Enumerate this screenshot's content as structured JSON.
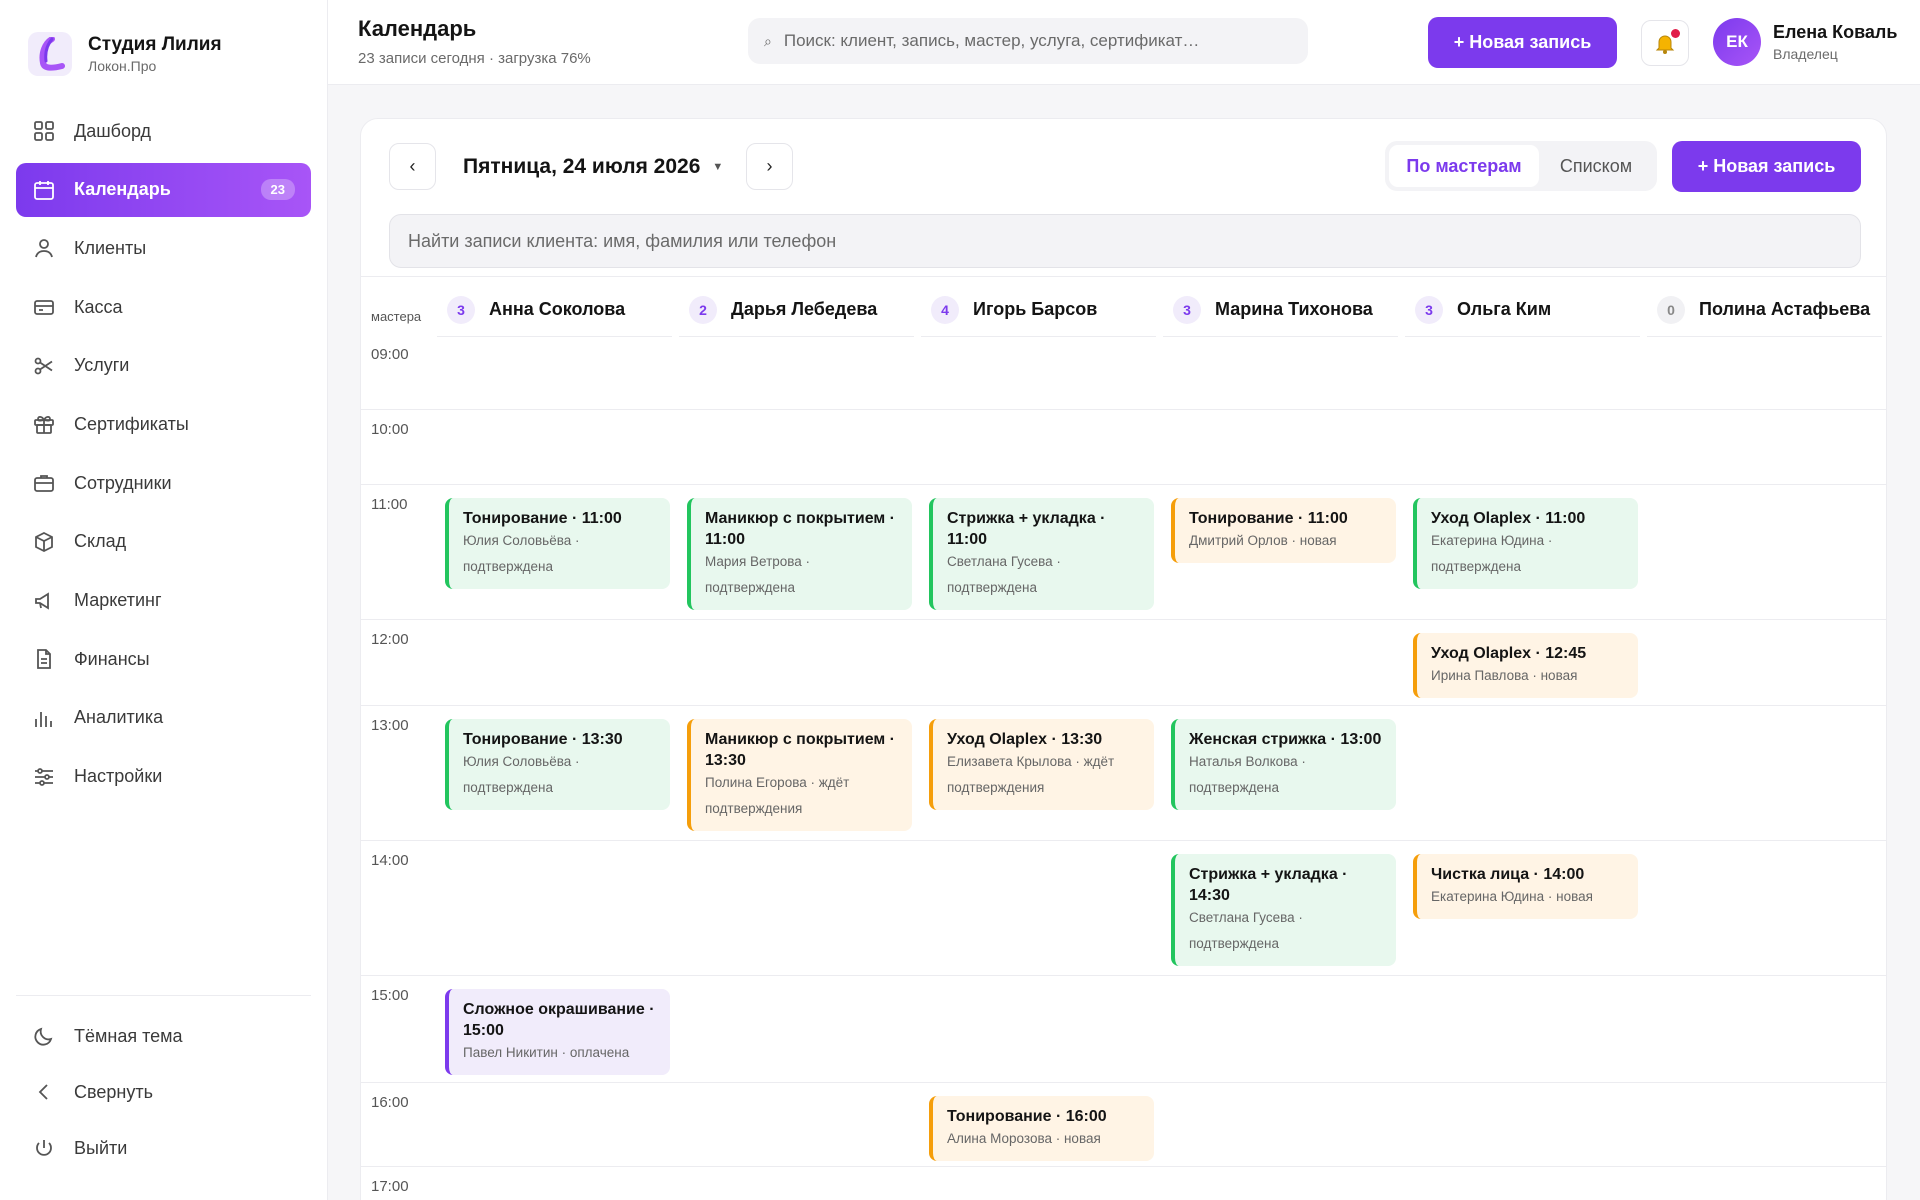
{
  "brand": {
    "name": "Студия Лилия",
    "subtitle": "Локон.Про"
  },
  "nav": [
    {
      "label": "Дашборд",
      "icon": "dashboard-icon"
    },
    {
      "label": "Календарь",
      "icon": "calendar-icon",
      "badge": "23",
      "active": true
    },
    {
      "label": "Клиенты",
      "icon": "user-icon"
    },
    {
      "label": "Касса",
      "icon": "credit-card-icon"
    },
    {
      "label": "Услуги",
      "icon": "scissors-icon"
    },
    {
      "label": "Сертификаты",
      "icon": "gift-icon"
    },
    {
      "label": "Сотрудники",
      "icon": "briefcase-icon"
    },
    {
      "label": "Склад",
      "icon": "box-icon"
    },
    {
      "label": "Маркетинг",
      "icon": "megaphone-icon"
    },
    {
      "label": "Финансы",
      "icon": "document-icon"
    },
    {
      "label": "Аналитика",
      "icon": "bar-chart-icon"
    },
    {
      "label": "Настройки",
      "icon": "sliders-icon"
    }
  ],
  "bottom_nav": [
    {
      "label": "Тёмная тема",
      "icon": "moon-icon"
    },
    {
      "label": "Свернуть",
      "icon": "chevron-left-icon"
    },
    {
      "label": "Выйти",
      "icon": "power-icon"
    }
  ],
  "header": {
    "title": "Календарь",
    "subtitle": "23 записи сегодня · загрузка 76%",
    "search_placeholder": "Поиск: клиент, запись, мастер, услуга, сертификат…",
    "new_button": "+ Новая запись",
    "user": {
      "initials": "ЕК",
      "name": "Елена Коваль",
      "role": "Владелец"
    }
  },
  "calendar": {
    "prev": "‹",
    "next": "›",
    "date": "Пятница, 24 июля 2026",
    "views": [
      "По мастерам",
      "Списком"
    ],
    "new_button": "+ Новая запись",
    "client_search_placeholder": "Найти записи клиента: имя, фамилия или телефон",
    "masters_label": "мастера",
    "masters": [
      {
        "count": "3",
        "name": "Анна Соколова"
      },
      {
        "count": "2",
        "name": "Дарья Лебедева"
      },
      {
        "count": "4",
        "name": "Игорь Барсов"
      },
      {
        "count": "3",
        "name": "Марина Тихонова"
      },
      {
        "count": "3",
        "name": "Ольга Ким"
      },
      {
        "count": "0",
        "name": "Полина Астафьева"
      }
    ],
    "hours": [
      "09:00",
      "10:00",
      "11:00",
      "12:00",
      "13:00",
      "14:00",
      "15:00",
      "16:00",
      "17:00"
    ],
    "appointments": [
      {
        "master": 0,
        "slot": 2,
        "status": "green",
        "title": "Тонирование · 11:00",
        "line1": "Юлия Соловьёва ·",
        "line2": "подтверждена"
      },
      {
        "master": 1,
        "slot": 2,
        "status": "green",
        "title": "Маникюр с покрытием · 11:00",
        "line1": "Мария Ветрова ·",
        "line2": "подтверждена"
      },
      {
        "master": 2,
        "slot": 2,
        "status": "green",
        "title": "Стрижка + укладка · 11:00",
        "line1": "Светлана Гусева ·",
        "line2": "подтверждена"
      },
      {
        "master": 3,
        "slot": 2,
        "status": "orange",
        "title": "Тонирование · 11:00",
        "line1": "Дмитрий Орлов · новая",
        "line2": ""
      },
      {
        "master": 4,
        "slot": 2,
        "status": "green",
        "title": "Уход Olaplex · 11:00",
        "line1": "Екатерина Юдина ·",
        "line2": "подтверждена"
      },
      {
        "master": 4,
        "slot": 3,
        "status": "orange",
        "title": "Уход Olaplex · 12:45",
        "line1": "Ирина Павлова · новая",
        "line2": ""
      },
      {
        "master": 0,
        "slot": 4,
        "status": "green",
        "title": "Тонирование · 13:30",
        "line1": "Юлия Соловьёва ·",
        "line2": "подтверждена"
      },
      {
        "master": 1,
        "slot": 4,
        "status": "orange",
        "title": "Маникюр с покрытием · 13:30",
        "line1": "Полина Егорова · ждёт",
        "line2": "подтверждения"
      },
      {
        "master": 2,
        "slot": 4,
        "status": "orange",
        "title": "Уход Olaplex · 13:30",
        "line1": "Елизавета Крылова · ждёт",
        "line2": "подтверждения"
      },
      {
        "master": 3,
        "slot": 4,
        "status": "green",
        "title": "Женская стрижка · 13:00",
        "line1": "Наталья Волкова ·",
        "line2": "подтверждена"
      },
      {
        "master": 3,
        "slot": 5,
        "status": "green",
        "title": "Стрижка + укладка · 14:30",
        "line1": "Светлана Гусева ·",
        "line2": "подтверждена"
      },
      {
        "master": 4,
        "slot": 5,
        "status": "orange",
        "title": "Чистка лица · 14:00",
        "line1": "Екатерина Юдина · новая",
        "line2": ""
      },
      {
        "master": 0,
        "slot": 6,
        "status": "purple",
        "title": "Сложное окрашивание · 15:00",
        "line1": "Павел Никитин · оплачена",
        "line2": ""
      },
      {
        "master": 2,
        "slot": 7,
        "status": "orange",
        "title": "Тонирование · 16:00",
        "line1": "Алина Морозова · новая",
        "line2": ""
      }
    ]
  },
  "colors": {
    "accent": "#7c3aed",
    "confirmed": "#22c55e",
    "pending": "#f59e0b",
    "paid": "#7c3aed"
  }
}
